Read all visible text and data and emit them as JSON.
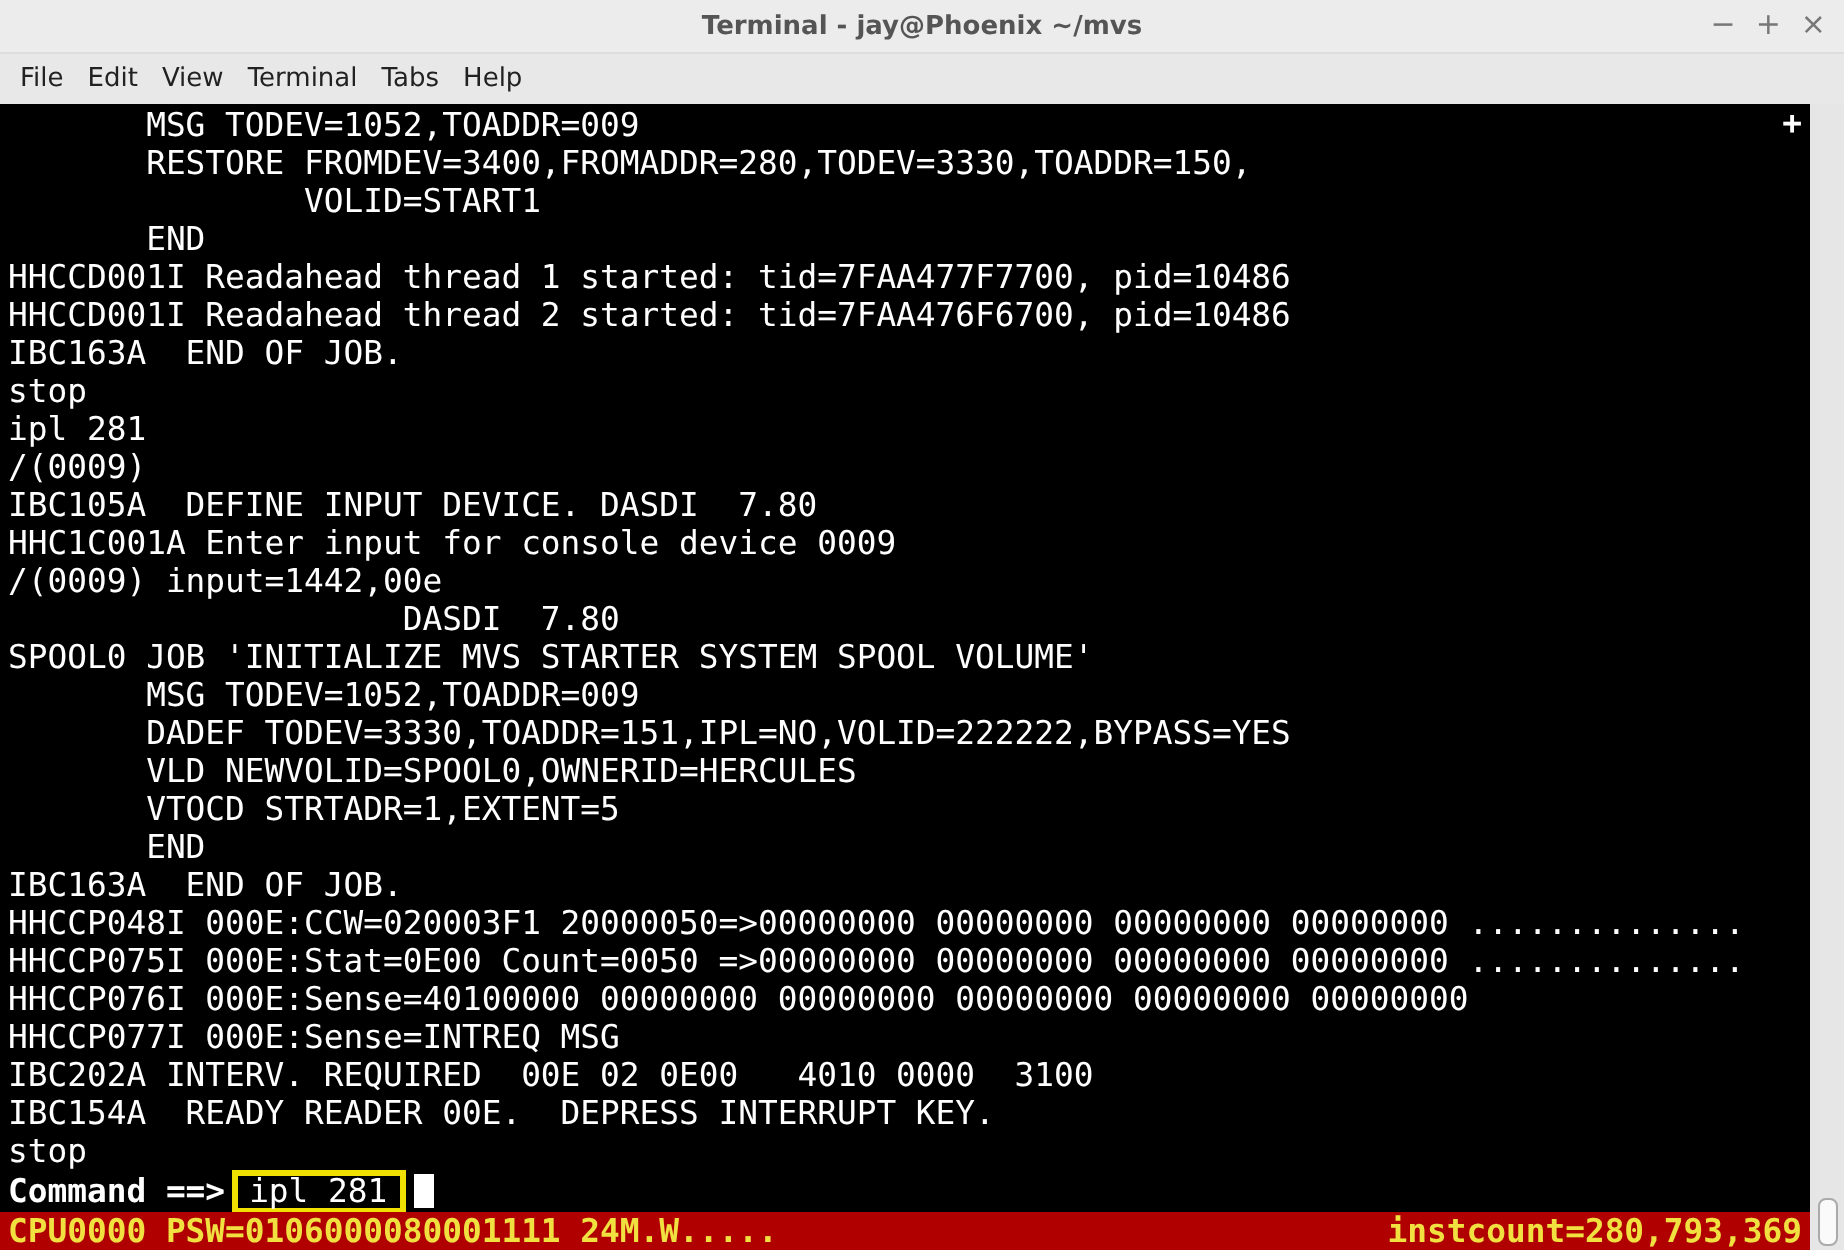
{
  "window": {
    "title": "Terminal - jay@Phoenix ~/mvs",
    "controls": [
      "−",
      "+",
      "×"
    ]
  },
  "menu": [
    "File",
    "Edit",
    "View",
    "Terminal",
    "Tabs",
    "Help"
  ],
  "terminal": {
    "corner_mark": "+",
    "lines": [
      "       MSG TODEV=1052,TOADDR=009",
      "       RESTORE FROMDEV=3400,FROMADDR=280,TODEV=3330,TOADDR=150,",
      "               VOLID=START1",
      "       END",
      "HHCCD001I Readahead thread 1 started: tid=7FAA477F7700, pid=10486",
      "HHCCD001I Readahead thread 2 started: tid=7FAA476F6700, pid=10486",
      "IBC163A  END OF JOB.",
      "stop",
      "ipl 281",
      "/(0009)",
      "IBC105A  DEFINE INPUT DEVICE. DASDI  7.80",
      "HHC1C001A Enter input for console device 0009",
      "/(0009) input=1442,00e",
      "                    DASDI  7.80",
      "SPOOL0 JOB 'INITIALIZE MVS STARTER SYSTEM SPOOL VOLUME'",
      "       MSG TODEV=1052,TOADDR=009",
      "       DADEF TODEV=3330,TOADDR=151,IPL=NO,VOLID=222222,BYPASS=YES",
      "       VLD NEWVOLID=SPOOL0,OWNERID=HERCULES",
      "       VTOCD STRTADR=1,EXTENT=5",
      "       END",
      "IBC163A  END OF JOB.",
      "HHCCP048I 000E:CCW=020003F1 20000050=>00000000 00000000 00000000 00000000 ..............",
      "HHCCP075I 000E:Stat=0E00 Count=0050 =>00000000 00000000 00000000 00000000 ..............",
      "HHCCP076I 000E:Sense=40100000 00000000 00000000 00000000 00000000 00000000",
      "HHCCP077I 000E:Sense=INTREQ MSG",
      "IBC202A INTERV. REQUIRED  00E 02 0E00   4010 0000  3100",
      "IBC154A  READY READER 00E.  DEPRESS INTERRUPT KEY.",
      "stop"
    ],
    "prompt": "Command ==>",
    "command": "ipl 281"
  },
  "status_bar": {
    "left": "CPU0000 PSW=0106000080001111 24M.W.....",
    "right": "instcount=280,793,369"
  }
}
